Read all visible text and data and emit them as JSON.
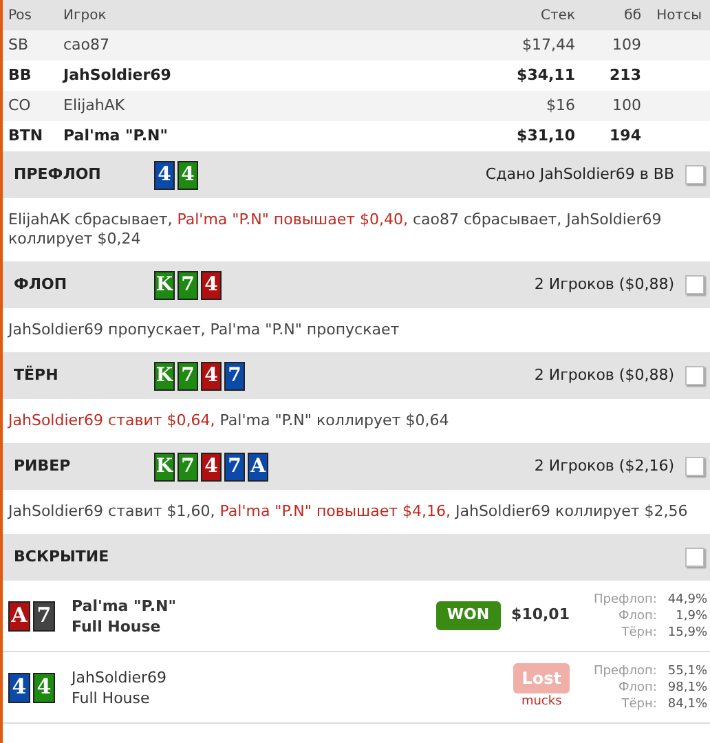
{
  "players_table": {
    "columns": [
      "Pos",
      "Игрок",
      "Стек",
      "бб",
      "Нотсы"
    ],
    "rows": [
      {
        "pos": "SB",
        "player": "cao87",
        "stack": "$17,44",
        "bb": "109",
        "bold": false
      },
      {
        "pos": "BB",
        "player": "JahSoldier69",
        "stack": "$34,11",
        "bb": "213",
        "bold": true
      },
      {
        "pos": "CO",
        "player": "ElijahAK",
        "stack": "$16",
        "bb": "100",
        "bold": false
      },
      {
        "pos": "BTN",
        "player": "Pal'ma \"P.N\"",
        "stack": "$31,10",
        "bb": "194",
        "bold": true
      }
    ]
  },
  "streets": [
    {
      "name": "ПРЕФЛОП",
      "cards": [
        {
          "rank": "4",
          "color": "#0b4aa8"
        },
        {
          "rank": "4",
          "color": "#1f8a12"
        }
      ],
      "info": "Сдано JahSoldier69 в BB",
      "checked": false,
      "actions": [
        {
          "text": "ElijahAK сбрасывает, ",
          "highlight": false
        },
        {
          "text": "Pal'ma \"P.N\" повышает $0,40,",
          "highlight": true
        },
        {
          "text": " cao87 сбрасывает, JahSoldier69 коллирует $0,24",
          "highlight": false
        }
      ]
    },
    {
      "name": "ФЛОП",
      "cards": [
        {
          "rank": "K",
          "color": "#1f8a12"
        },
        {
          "rank": "7",
          "color": "#1f8a12"
        },
        {
          "rank": "4",
          "color": "#b01010"
        }
      ],
      "info": "2 Игроков ($0,88)",
      "checked": false,
      "actions": [
        {
          "text": "JahSoldier69 пропускает, Pal'ma \"P.N\" пропускает",
          "highlight": false
        }
      ]
    },
    {
      "name": "ТЁРН",
      "cards": [
        {
          "rank": "K",
          "color": "#1f8a12"
        },
        {
          "rank": "7",
          "color": "#1f8a12"
        },
        {
          "rank": "4",
          "color": "#b01010"
        },
        {
          "rank": "7",
          "color": "#0b4aa8"
        }
      ],
      "info": "2 Игроков ($0,88)",
      "checked": false,
      "actions": [
        {
          "text": "JahSoldier69 ставит $0,64,",
          "highlight": true
        },
        {
          "text": " Pal'ma \"P.N\" коллирует $0,64",
          "highlight": false
        }
      ]
    },
    {
      "name": "РИВЕР",
      "cards": [
        {
          "rank": "K",
          "color": "#1f8a12"
        },
        {
          "rank": "7",
          "color": "#1f8a12"
        },
        {
          "rank": "4",
          "color": "#b01010"
        },
        {
          "rank": "7",
          "color": "#0b4aa8"
        },
        {
          "rank": "A",
          "color": "#0b4aa8"
        }
      ],
      "info": "2 Игроков ($2,16)",
      "checked": false,
      "actions": [
        {
          "text": "JahSoldier69 ставит $1,60, ",
          "highlight": false
        },
        {
          "text": "Pal'ma \"P.N\" повышает $4,16,",
          "highlight": true
        },
        {
          "text": " JahSoldier69 коллирует $2,56",
          "highlight": false
        }
      ]
    }
  ],
  "showdown": {
    "name": "ВСКРЫТИЕ",
    "checked": false,
    "hands": [
      {
        "cards": [
          {
            "rank": "A",
            "color": "#b01010"
          },
          {
            "rank": "7",
            "color": "#444444"
          }
        ],
        "player": "Pal'ma \"P.N\"",
        "hand": "Full House",
        "bold": true,
        "result": {
          "kind": "won",
          "label": "WON"
        },
        "amount": "$10,01",
        "equity": [
          {
            "label": "Префлоп:",
            "value": "44,9%"
          },
          {
            "label": "Флоп:",
            "value": "1,9%"
          },
          {
            "label": "Тёрн:",
            "value": "15,9%"
          }
        ]
      },
      {
        "cards": [
          {
            "rank": "4",
            "color": "#0b4aa8"
          },
          {
            "rank": "4",
            "color": "#1f8a12"
          }
        ],
        "player": "JahSoldier69",
        "hand": "Full House",
        "bold": false,
        "result": {
          "kind": "lost",
          "label": "Lost",
          "note": "mucks"
        },
        "equity": [
          {
            "label": "Префлоп:",
            "value": "55,1%"
          },
          {
            "label": "Флоп:",
            "value": "98,1%"
          },
          {
            "label": "Тёрн:",
            "value": "84,1%"
          }
        ]
      }
    ]
  }
}
